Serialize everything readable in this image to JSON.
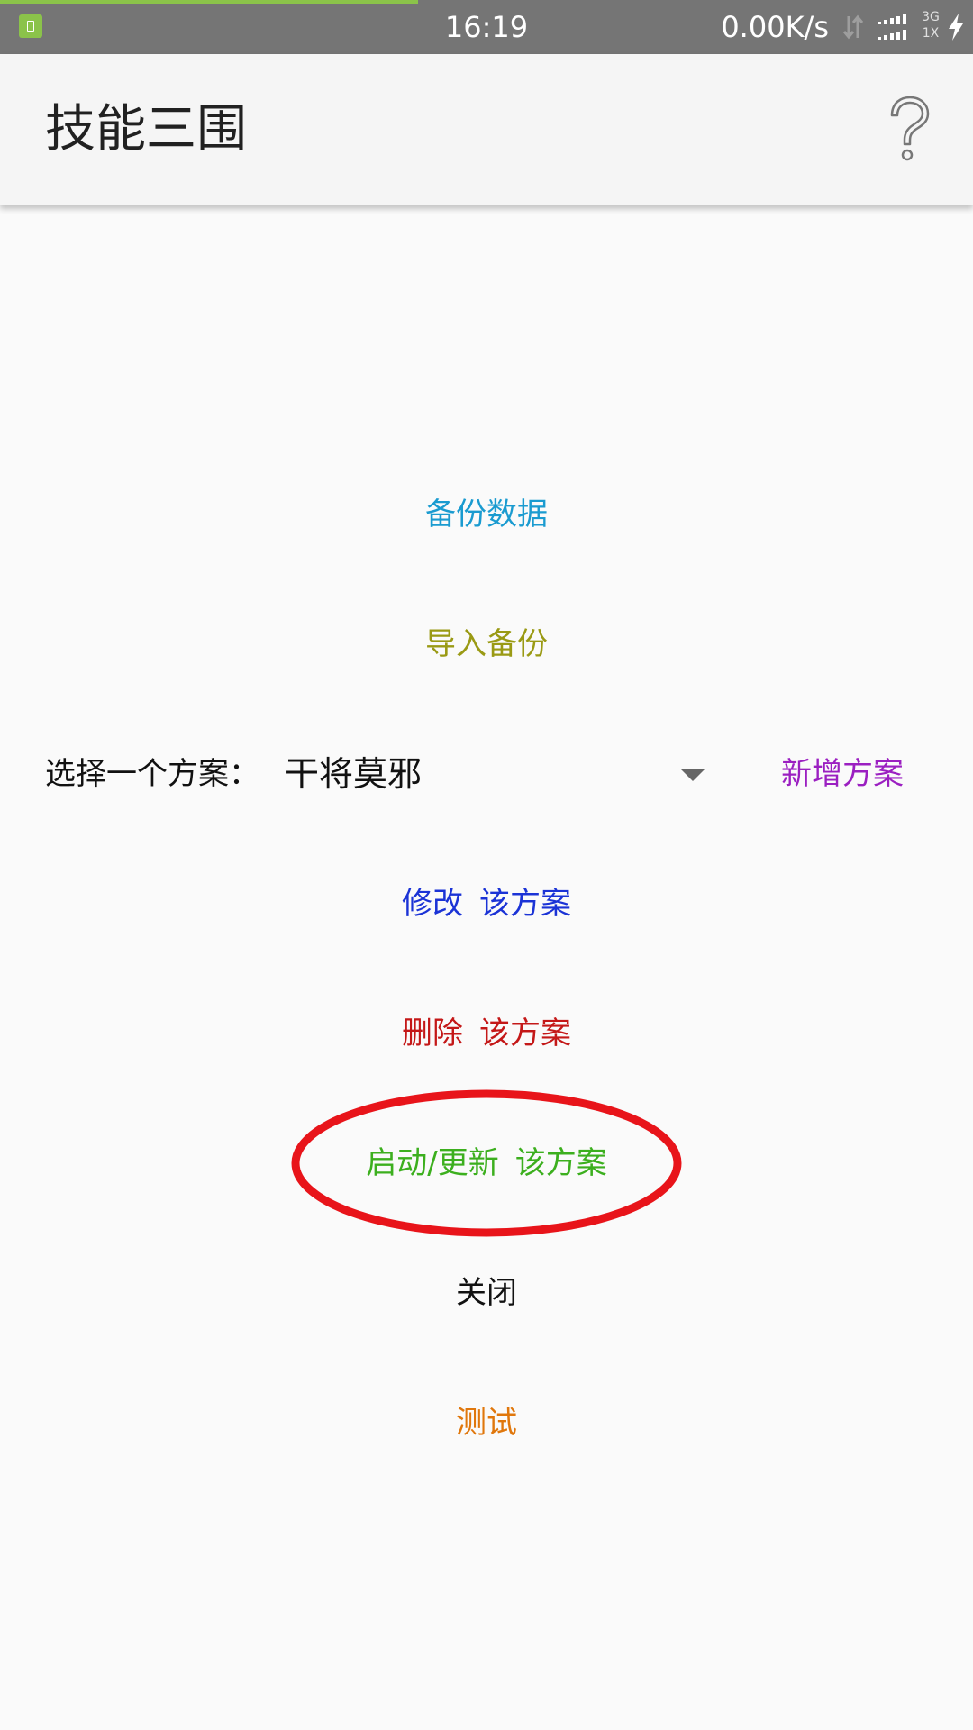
{
  "status_bar": {
    "time": "16:19",
    "net_speed": "0.00K/s",
    "network_type_top": "3G",
    "network_type_bottom": "1X",
    "page_load_progress": 0.43
  },
  "app_bar": {
    "title": "技能三围",
    "help_icon": "question-mark-icon"
  },
  "actions": {
    "backup": "备份数据",
    "import": "导入备份",
    "edit_verb": "修改",
    "delete_verb": "删除",
    "start_verb": "启动/更新",
    "plan_suffix": "该方案",
    "close": "关闭",
    "test": "测试"
  },
  "plan": {
    "label": "选择一个方案：",
    "selected": "干将莫邪",
    "add_button": "新增方案"
  },
  "colors": {
    "status_bar": "#757575",
    "app_bar": "#f5f5f5",
    "background": "#fafafa",
    "backup": "#1a9bd0",
    "import": "#9a9a14",
    "add_plan": "#9b1fc1",
    "edit": "#1b33d6",
    "delete": "#c41818",
    "start": "#3caf1e",
    "close": "#111111",
    "test": "#e0770c",
    "annotation": "#e8141a"
  }
}
